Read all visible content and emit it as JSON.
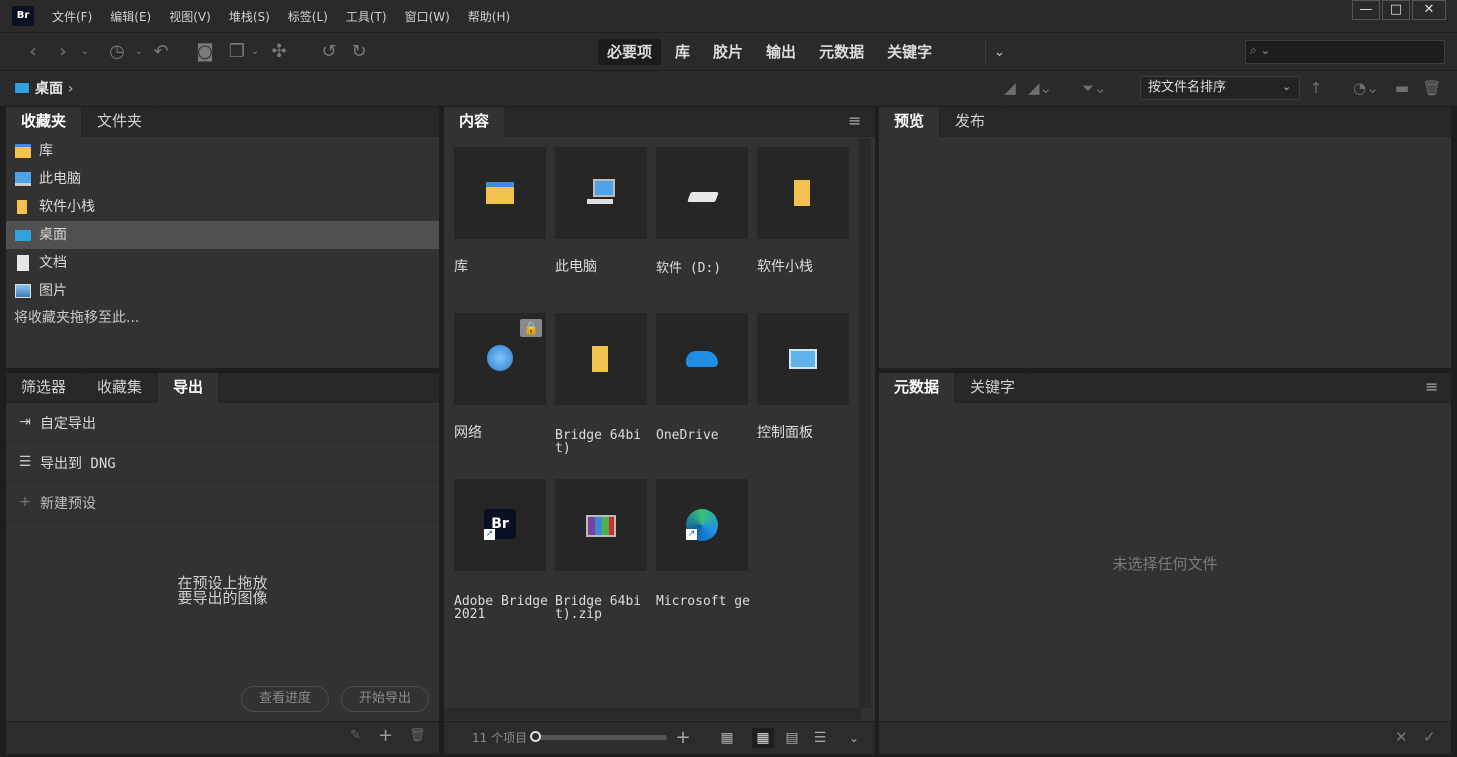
{
  "titlebar": {
    "logo": "Br",
    "menu": [
      "文件(F)",
      "编辑(E)",
      "视图(V)",
      "堆栈(S)",
      "标签(L)",
      "工具(T)",
      "窗口(W)",
      "帮助(H)"
    ],
    "min": "—",
    "max": "□",
    "close": "✕"
  },
  "toolbar": {
    "workspaces": [
      "必要项",
      "库",
      "胶片",
      "输出",
      "元数据",
      "关键字"
    ],
    "active_workspace": "必要项",
    "more": "⌄",
    "search_placeholder": ""
  },
  "pathbar": {
    "location": "桌面",
    "separator": "›",
    "sort_label": "按文件名排序"
  },
  "favorites_panel": {
    "tabs": [
      "收藏夹",
      "文件夹"
    ],
    "items": [
      "库",
      "此电脑",
      "软件小栈",
      "桌面",
      "文档",
      "图片"
    ],
    "selected": "桌面",
    "hint": "将收藏夹拖移至此..."
  },
  "export_panel": {
    "tabs": [
      "筛选器",
      "收藏集",
      "导出"
    ],
    "items": [
      "自定导出",
      "导出到 DNG",
      "新建预设"
    ],
    "drop_hint_line1": "在预设上拖放",
    "drop_hint_line2": "要导出的图像",
    "view_progress": "查看进度",
    "start_export": "开始导出"
  },
  "content_panel": {
    "tab": "内容",
    "items": [
      {
        "label": "库",
        "icon": "library-folder-icon"
      },
      {
        "label": "此电脑",
        "icon": "computer-icon"
      },
      {
        "label": "软件 (D:)",
        "icon": "drive-icon"
      },
      {
        "label": "软件小栈",
        "icon": "folder-icon"
      },
      {
        "label": "网络",
        "icon": "network-icon"
      },
      {
        "label": "Bridge 64bit)",
        "icon": "folder-icon"
      },
      {
        "label": "OneDrive",
        "icon": "onedrive-icon"
      },
      {
        "label": "控制面板",
        "icon": "control-panel-icon"
      },
      {
        "label": "Adobe Bridge 2021",
        "icon": "bridge-app-icon"
      },
      {
        "label": "Bridge 64bit).zip",
        "icon": "archive-icon"
      },
      {
        "label": "Microsoft ge",
        "icon": "edge-icon"
      }
    ],
    "item_count": "11 个项目"
  },
  "preview_panel": {
    "tabs": [
      "预览",
      "发布"
    ]
  },
  "metadata_panel": {
    "tabs": [
      "元数据",
      "关键字"
    ],
    "empty": "未选择任何文件"
  },
  "colors": {
    "folder": "#f2c14e",
    "accent_blue": "#2fa0e0",
    "bridge_bg": "#0b0f24"
  }
}
